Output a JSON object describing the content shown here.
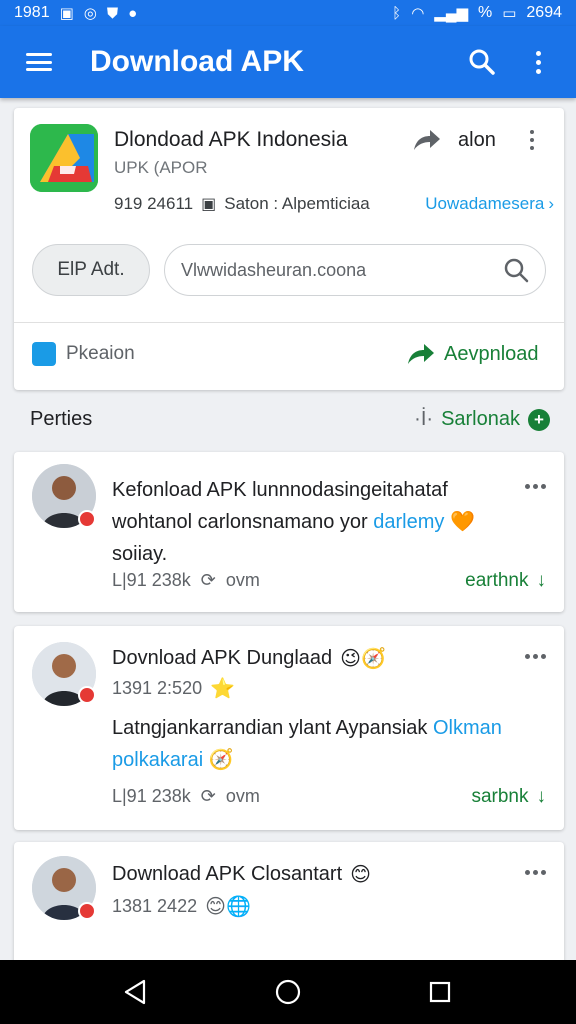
{
  "status_bar": {
    "time": "1981",
    "battery_percent": "%",
    "battery_time": "2694"
  },
  "app_bar": {
    "title": "Download APK"
  },
  "app_card": {
    "name": "Dlondoad APK Indonesia",
    "subtitle": "UPK (APOR",
    "share_label": "alon",
    "meta_count": "919 24611",
    "meta_category": "Saton : Alpemticiaa",
    "meta_link": "Uowadamesera",
    "pill_button_label": "ElP Adt.",
    "search_value": "Vlwwidasheuran.coona",
    "preview_label": "Pkeaion",
    "download_label": "Aevpnload"
  },
  "section": {
    "title": "Perties",
    "action_label": "Sarlonak",
    "action_prefix": "·İ·"
  },
  "posts": [
    {
      "text_main": "Kefonload APK lunnnodasingeitahataf wohtanol carlonsnamano yor",
      "text_highlight": "darlemy",
      "text_end": "soiiay.",
      "emoji": "🧡",
      "meta_count": "L|91 238k",
      "meta_tag": "ovm",
      "action_label": "earthnk"
    },
    {
      "title": "Dovnload APK Dunglaad",
      "title_emoji": "😉🧭",
      "date": "1391 2:520",
      "date_emoji": "⭐",
      "text_main": "Latngjankarrandian ylant Aypansiak",
      "text_highlight": "Olkman polkakarai",
      "text_emoji": "🧭",
      "meta_count": "L|91 238k",
      "meta_tag": "ovm",
      "action_label": "sarbnk"
    },
    {
      "title": "Download APK Closantart",
      "title_emoji": "😊",
      "date": "1381 2422",
      "date_emoji": "😊🌐"
    }
  ],
  "colors": {
    "brand": "#1a73e8",
    "link": "#1a9be6",
    "action_green": "#188038"
  }
}
